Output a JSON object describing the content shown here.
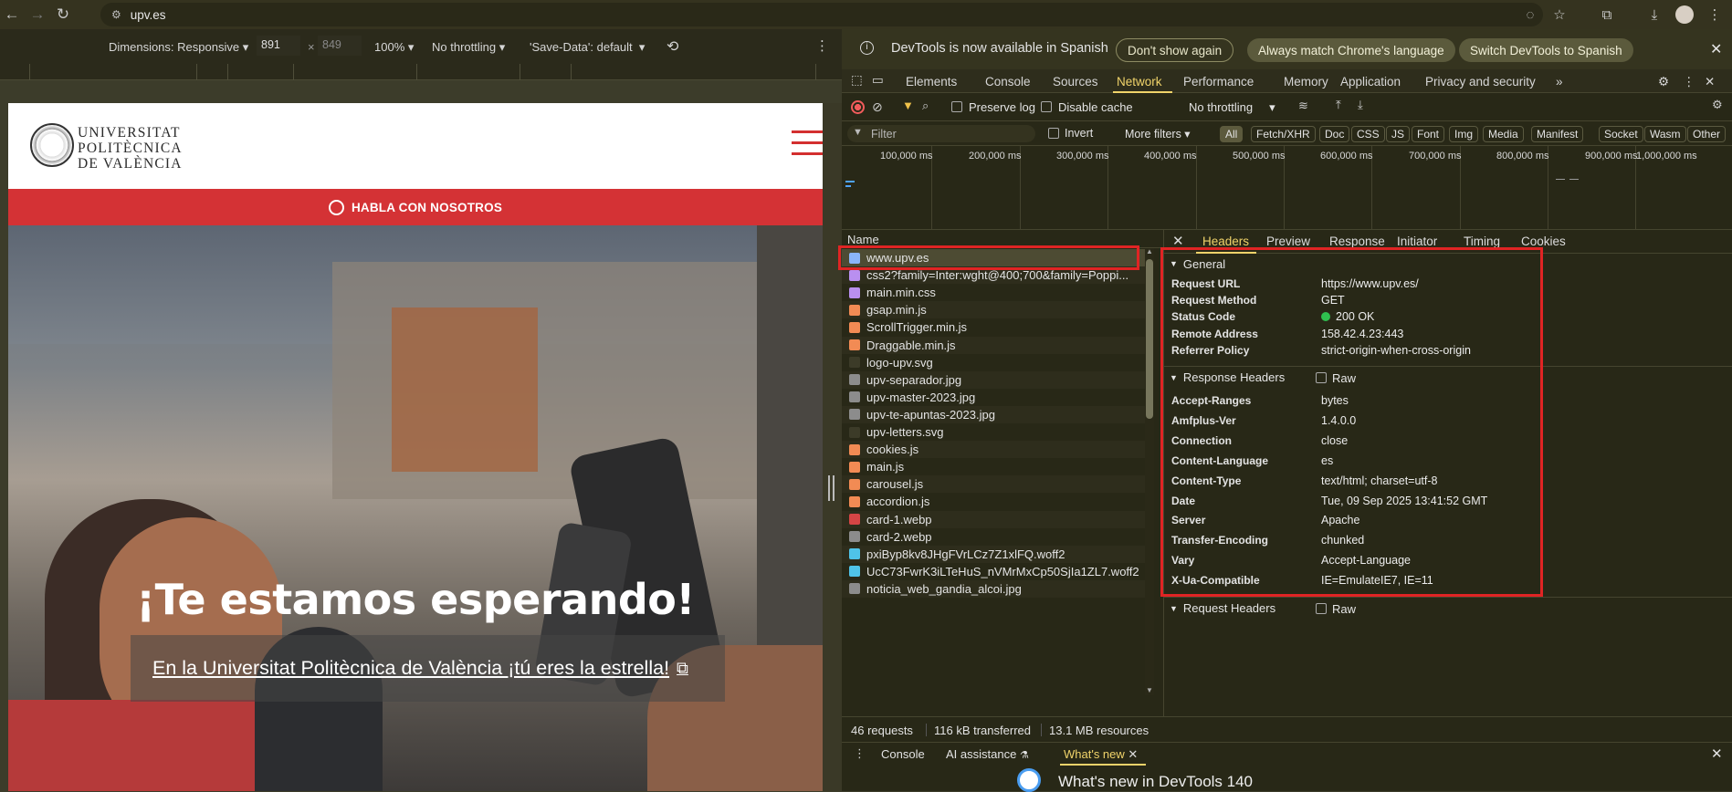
{
  "browser": {
    "url": "upv.es",
    "back_icon": "←",
    "forward_icon": "→",
    "reload_icon": "↻"
  },
  "device_toolbar": {
    "dimensions_label": "Dimensions: Responsive",
    "width": "891",
    "times": "×",
    "height": "849",
    "zoom": "100%",
    "throttling": "No throttling",
    "save_data": "'Save-Data': default"
  },
  "site": {
    "logo_lines": [
      "UNIVERSITAT",
      "POLITÈCNICA",
      "DE VALÈNCIA"
    ],
    "banner_text": "HABLA CON NOSOTROS",
    "hero_title": "¡Te estamos esperando!",
    "hero_subtitle": "En la Universitat Politècnica de València ¡tú eres la estrella!"
  },
  "devtools": {
    "infobar": {
      "message": "DevTools is now available in Spanish",
      "btn_dont_show": "Don't show again",
      "btn_match": "Always match Chrome's language",
      "btn_switch": "Switch DevTools to Spanish"
    },
    "tabs": [
      "Elements",
      "Console",
      "Sources",
      "Network",
      "Performance",
      "Memory",
      "Application",
      "Privacy and security"
    ],
    "active_tab": "Network",
    "toolbar": {
      "preserve_log": "Preserve log",
      "disable_cache": "Disable cache",
      "throttling": "No throttling"
    },
    "filter": {
      "placeholder": "Filter",
      "invert": "Invert",
      "more_filters": "More filters",
      "chips": [
        "All",
        "Fetch/XHR",
        "Doc",
        "CSS",
        "JS",
        "Font",
        "Img",
        "Media",
        "Manifest",
        "Socket",
        "Wasm",
        "Other"
      ]
    },
    "timeline_labels": [
      "100,000 ms",
      "200,000 ms",
      "300,000 ms",
      "400,000 ms",
      "500,000 ms",
      "600,000 ms",
      "700,000 ms",
      "800,000 ms",
      "900,000 ms",
      "1,000,000 ms"
    ],
    "requests_header": "Name",
    "requests": [
      {
        "name": "www.upv.es",
        "type": "doc",
        "color": "#8ab4f8"
      },
      {
        "name": "css2?family=Inter:wght@400;700&family=Poppi...",
        "type": "css",
        "color": "#b98ff0"
      },
      {
        "name": "main.min.css",
        "type": "css",
        "color": "#b98ff0"
      },
      {
        "name": "gsap.min.js",
        "type": "js",
        "color": "#f28b54"
      },
      {
        "name": "ScrollTrigger.min.js",
        "type": "js",
        "color": "#f28b54"
      },
      {
        "name": "Draggable.min.js",
        "type": "js",
        "color": "#f28b54"
      },
      {
        "name": "logo-upv.svg",
        "type": "img",
        "color": "#3c3b28"
      },
      {
        "name": "upv-separador.jpg",
        "type": "img",
        "color": "#8c8c8c"
      },
      {
        "name": "upv-master-2023.jpg",
        "type": "img",
        "color": "#8c8c8c"
      },
      {
        "name": "upv-te-apuntas-2023.jpg",
        "type": "img",
        "color": "#8c8c8c"
      },
      {
        "name": "upv-letters.svg",
        "type": "img",
        "color": "#3c3b28"
      },
      {
        "name": "cookies.js",
        "type": "js",
        "color": "#f28b54"
      },
      {
        "name": "main.js",
        "type": "js",
        "color": "#f28b54"
      },
      {
        "name": "carousel.js",
        "type": "js",
        "color": "#f28b54"
      },
      {
        "name": "accordion.js",
        "type": "js",
        "color": "#f28b54"
      },
      {
        "name": "card-1.webp",
        "type": "img",
        "color": "#d64545"
      },
      {
        "name": "card-2.webp",
        "type": "img",
        "color": "#8c8c8c"
      },
      {
        "name": "pxiByp8kv8JHgFVrLCz7Z1xlFQ.woff2",
        "type": "font",
        "color": "#4fc3e8"
      },
      {
        "name": "UcC73FwrK3iLTeHuS_nVMrMxCp50SjIa1ZL7.woff2",
        "type": "font",
        "color": "#4fc3e8"
      },
      {
        "name": "noticia_web_gandia_alcoi.jpg",
        "type": "img",
        "color": "#8c8c8c"
      }
    ],
    "status": {
      "requests": "46 requests",
      "transferred": "116 kB transferred",
      "resources": "13.1 MB resources"
    },
    "detail_tabs": [
      "Headers",
      "Preview",
      "Response",
      "Initiator",
      "Timing",
      "Cookies"
    ],
    "active_detail_tab": "Headers",
    "general": {
      "title": "General",
      "rows": [
        {
          "k": "Request URL",
          "v": "https://www.upv.es/"
        },
        {
          "k": "Request Method",
          "v": "GET"
        },
        {
          "k": "Status Code",
          "v": "200 OK"
        },
        {
          "k": "Remote Address",
          "v": "158.42.4.23:443"
        },
        {
          "k": "Referrer Policy",
          "v": "strict-origin-when-cross-origin"
        }
      ]
    },
    "response_headers": {
      "title": "Response Headers",
      "raw": "Raw",
      "rows": [
        {
          "k": "Accept-Ranges",
          "v": "bytes"
        },
        {
          "k": "Amfplus-Ver",
          "v": "1.4.0.0"
        },
        {
          "k": "Connection",
          "v": "close"
        },
        {
          "k": "Content-Language",
          "v": "es"
        },
        {
          "k": "Content-Type",
          "v": "text/html; charset=utf-8"
        },
        {
          "k": "Date",
          "v": "Tue, 09 Sep 2025 13:41:52 GMT"
        },
        {
          "k": "Server",
          "v": "Apache"
        },
        {
          "k": "Transfer-Encoding",
          "v": "chunked"
        },
        {
          "k": "Vary",
          "v": "Accept-Language"
        },
        {
          "k": "X-Ua-Compatible",
          "v": "IE=EmulateIE7, IE=11"
        }
      ]
    },
    "request_headers": {
      "title": "Request Headers",
      "raw": "Raw"
    },
    "drawer": {
      "tabs": [
        "Console",
        "AI assistance",
        "What's new"
      ],
      "whats_new_title": "What's new in DevTools 140"
    },
    "colors": {
      "accent": "#f0d36a",
      "status_ok": "#2fbf4f",
      "highlight": "#e02424"
    }
  }
}
